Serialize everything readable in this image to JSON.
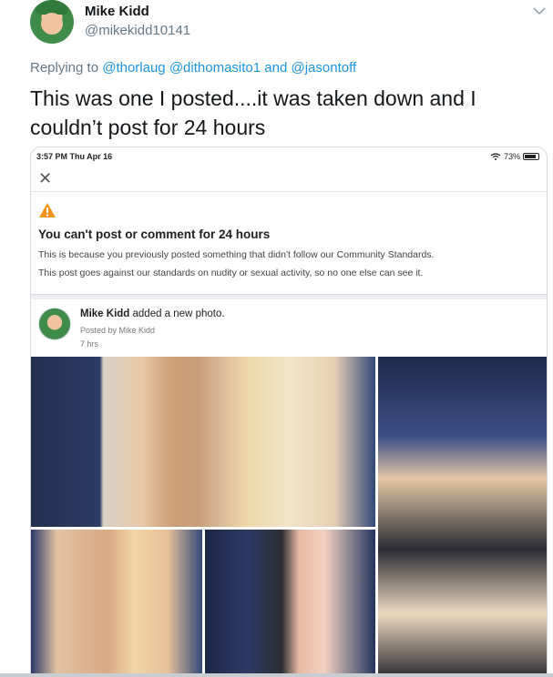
{
  "tweet": {
    "author_name": "Mike Kidd",
    "author_handle": "@mikekidd10141",
    "reply_prefix": "Replying to",
    "reply_mention_1": "@thorlaug",
    "reply_mention_2": "@dithomasito1",
    "reply_and": "and",
    "reply_mention_3": "@jasontoff",
    "text": "This was one I posted....it was taken down and I couldn’t post for 24 hours"
  },
  "screenshot": {
    "status_time": "3:57 PM  Thu Apr 16",
    "battery_text": "73%",
    "close_icon": "close-icon",
    "notice_icon": "warning-icon",
    "notice_title": "You can't post or comment for 24 hours",
    "notice_line1": "This is because you previously posted something that didn't follow our Community Standards.",
    "notice_line2": "This post goes against our standards on nudity or sexual activity, so no one else can see it.",
    "post_author": "Mike Kidd",
    "post_action": " added a new photo.",
    "post_posted_by": "Posted by Mike Kidd",
    "post_time": "7 hrs"
  },
  "colors": {
    "link": "#1b95e0",
    "secondary_text": "#657786",
    "warning": "#f7931e"
  }
}
